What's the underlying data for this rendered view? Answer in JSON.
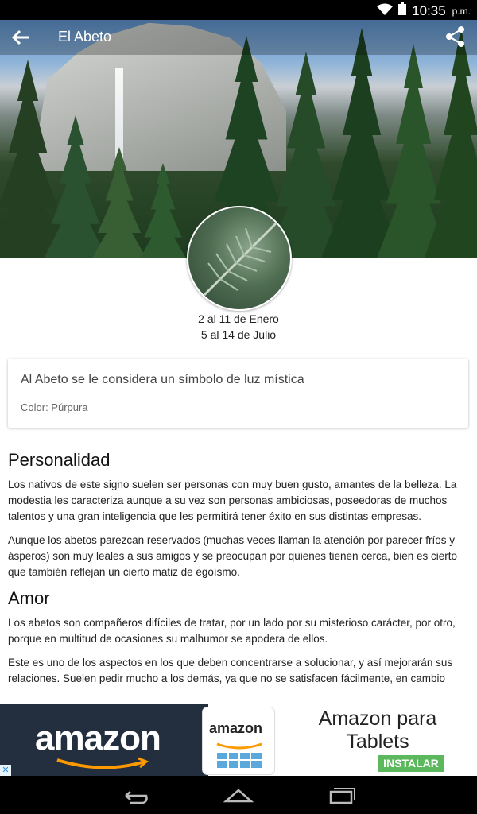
{
  "status_bar": {
    "time": "10:35",
    "ampm": "p.m.",
    "icons": [
      "wifi-icon",
      "battery-icon"
    ]
  },
  "toolbar": {
    "title": "El Abeto",
    "back_icon": "back-arrow-icon",
    "share_icon": "share-icon"
  },
  "dates": {
    "range1": "2 al 11 de Enero",
    "range2": "5 al 14 de Julio"
  },
  "card": {
    "symbol": "Al Abeto se le considera un símbolo de luz mística",
    "color": "Color: Púrpura"
  },
  "sections": {
    "personalidad": {
      "heading": "Personalidad",
      "p1": "Los nativos de este signo suelen ser personas con muy buen gusto, amantes de la belleza. La modestia les caracteriza aunque a su vez son personas ambiciosas, poseedoras de muchos talentos y una gran inteligencia que les permitirá tener éxito en sus distintas empresas.",
      "p2": "Aunque los abetos parezcan reservados (muchas veces llaman la atención por parecer fríos y ásperos) son muy leales a sus amigos y se preocupan por quienes tienen cerca, bien es cierto que también reflejan un cierto matiz de egoísmo."
    },
    "amor": {
      "heading": "Amor",
      "p1": "Los abetos son compañeros difíciles de tratar, por un lado por su misterioso carácter, por otro, porque en multitud de ocasiones su malhumor se apodera de ellos.",
      "p2": "Este es uno de los aspectos en los que deben concentrarse a solucionar, y así mejorarán sus relaciones. Suelen pedir mucho a los demás, ya que no se satisfacen fácilmente, en cambio"
    }
  },
  "ad": {
    "brand": "amazon",
    "logo_text": "amazon",
    "title": "Amazon para Tablets",
    "button": "INSTALAR",
    "close": "✕"
  },
  "colors": {
    "accent": "#5cb85c",
    "amazon_bg": "#232f3e",
    "amazon_orange": "#ff9900"
  }
}
